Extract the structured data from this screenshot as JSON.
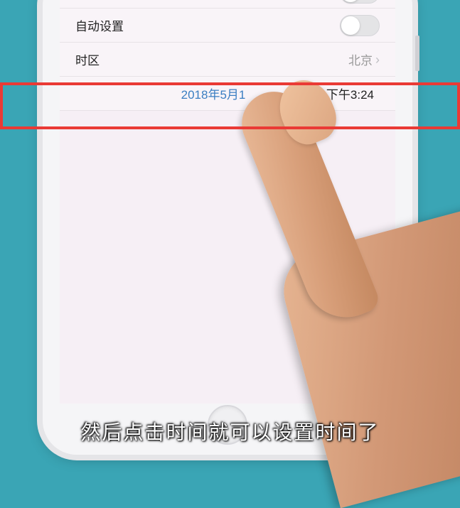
{
  "settings": {
    "auto_set": {
      "label": "自动设置",
      "enabled": false
    },
    "timezone": {
      "label": "时区",
      "value": "北京"
    },
    "datetime": {
      "date": "2018年5月1",
      "time": "下午3:24"
    }
  },
  "subtitle_text": "然后点击时间就可以设置时间了",
  "highlight": {
    "color": "#ea3a35"
  }
}
